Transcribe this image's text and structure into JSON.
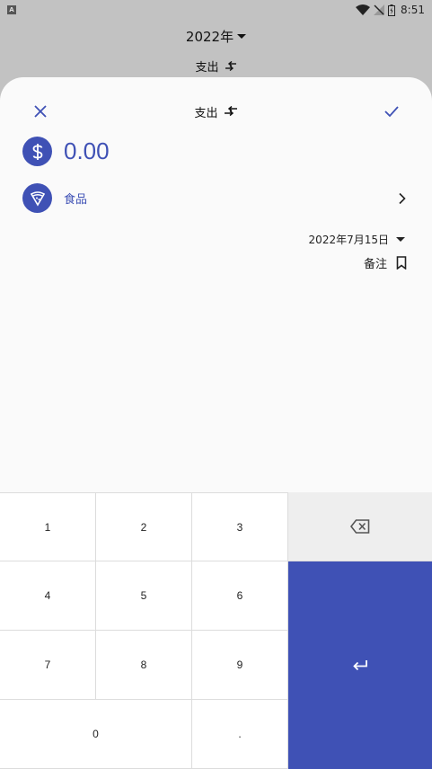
{
  "status_bar": {
    "notification_icon": "A",
    "time": "8:51"
  },
  "background": {
    "year": "2022年",
    "type": "支出"
  },
  "sheet": {
    "type_label": "支出",
    "amount": "0.00",
    "category": "食品",
    "date": "2022年7月15日",
    "note_label": "备注"
  },
  "keypad": {
    "keys": [
      "1",
      "2",
      "3",
      "4",
      "5",
      "6",
      "7",
      "8",
      "9",
      "0",
      "."
    ]
  },
  "colors": {
    "accent": "#3f51b5",
    "backspace_bg": "#eeeeee",
    "sheet_bg": "#fafafa",
    "scrim": "#c2c2c2"
  }
}
